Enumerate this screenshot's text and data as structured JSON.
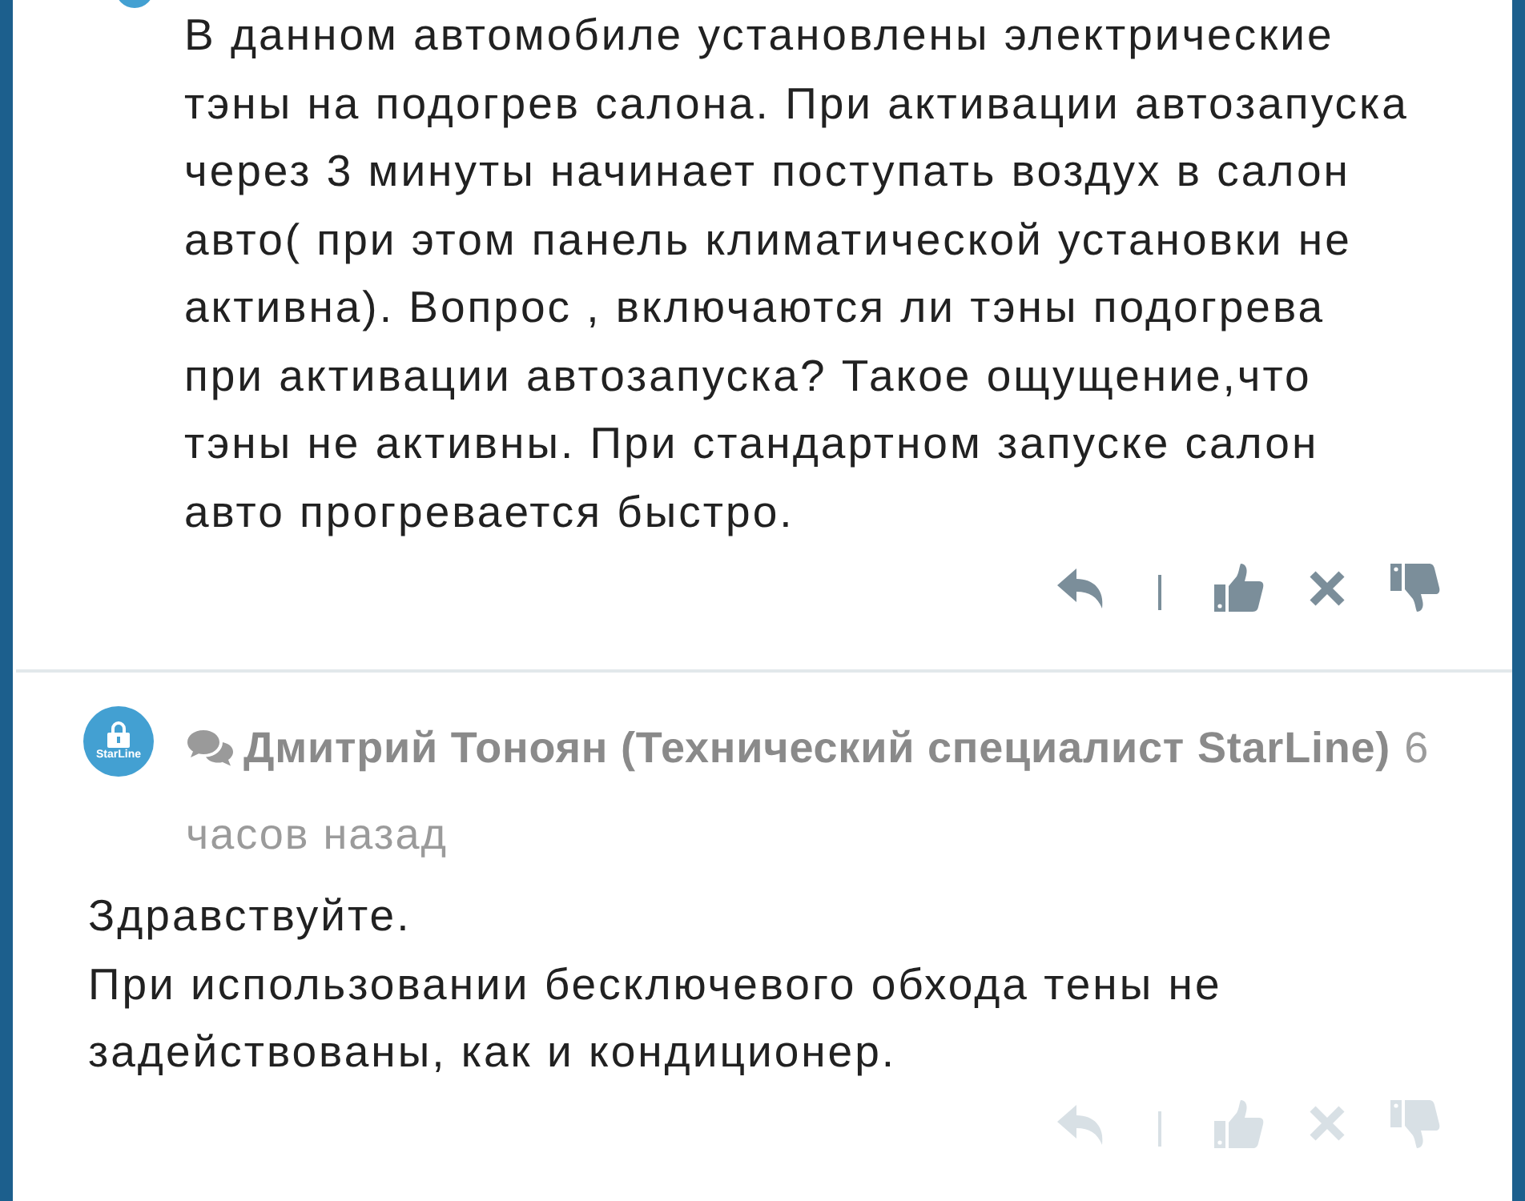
{
  "comments": [
    {
      "kind": "partial",
      "body": "В данном автомобиле установлены электрические\nтэны на подогрев салона. При активации автозапуска\nчерез 3 минуты начинает поступать воздух в салон\nавто( при этом панель климатической установки не\nактивна). Вопрос , включаются ли тэны подогрева\nпри активации автозапуска? Такое ощущение,что\nтэны не активны. При стандартном запуске салон\nавто прогревается быстро.",
      "actions": {
        "faded": false
      }
    },
    {
      "kind": "full",
      "avatar": {
        "label": "StarLine"
      },
      "author": "Дмитрий Тоноян (Технический специалист StarLine)",
      "time": "6 часов назад",
      "body": "Здравствуйте.\nПри использовании бесключевого обхода тены не\nзадействованы, как и кондиционер.",
      "actions": {
        "faded": true
      }
    }
  ]
}
